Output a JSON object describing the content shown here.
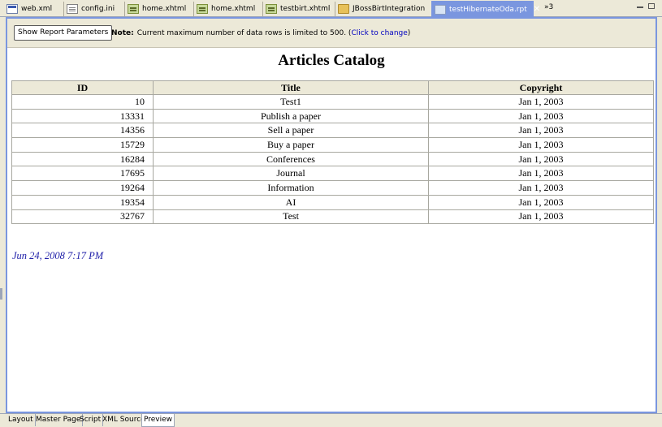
{
  "editor_tabs": [
    {
      "label": "web.xml",
      "icon": "xml-file-icon",
      "active": false
    },
    {
      "label": "config.ini",
      "icon": "ini-file-icon",
      "active": false
    },
    {
      "label": "home.xhtml",
      "icon": "xhtml-file-icon",
      "active": false
    },
    {
      "label": "home.xhtml",
      "icon": "xhtml-file-icon",
      "active": false
    },
    {
      "label": "testbirt.xhtml",
      "icon": "xhtml-file-icon",
      "active": false
    },
    {
      "label": "JBossBirtIntegration",
      "icon": "folder-icon",
      "active": false
    },
    {
      "label": "testHibernateOda.rpt",
      "icon": "report-file-icon",
      "active": true
    }
  ],
  "overflow_label": "»3",
  "toolbar": {
    "show_params_label": "Show Report Parameters",
    "note_label": "Note:",
    "note_text": "Current maximum number of data rows is limited to 500. (",
    "note_link": "Click to change",
    "note_end": ")"
  },
  "report": {
    "title": "Articles Catalog",
    "columns": [
      "ID",
      "Title",
      "Copyright"
    ],
    "rows": [
      {
        "id": "10",
        "title": "Test1",
        "copyright": "Jan 1, 2003"
      },
      {
        "id": "13331",
        "title": "Publish a paper",
        "copyright": "Jan 1, 2003"
      },
      {
        "id": "14356",
        "title": "Sell a paper",
        "copyright": "Jan 1, 2003"
      },
      {
        "id": "15729",
        "title": "Buy a paper",
        "copyright": "Jan 1, 2003"
      },
      {
        "id": "16284",
        "title": "Conferences",
        "copyright": "Jan 1, 2003"
      },
      {
        "id": "17695",
        "title": "Journal",
        "copyright": "Jan 1, 2003"
      },
      {
        "id": "19264",
        "title": "Information",
        "copyright": "Jan 1, 2003"
      },
      {
        "id": "19354",
        "title": "AI",
        "copyright": "Jan 1, 2003"
      },
      {
        "id": "32767",
        "title": "Test",
        "copyright": "Jan 1, 2003"
      }
    ],
    "footer_date": "Jun 24, 2008 7:17 PM"
  },
  "page_tabs": [
    {
      "label": "Layout",
      "active": false
    },
    {
      "label": "Master Page",
      "active": false
    },
    {
      "label": "Script",
      "active": false
    },
    {
      "label": "XML Source",
      "active": false
    },
    {
      "label": "Preview",
      "active": true
    }
  ],
  "colors": {
    "accent": "#7a96df",
    "date_text": "#2222aa",
    "link": "#0000c0"
  }
}
